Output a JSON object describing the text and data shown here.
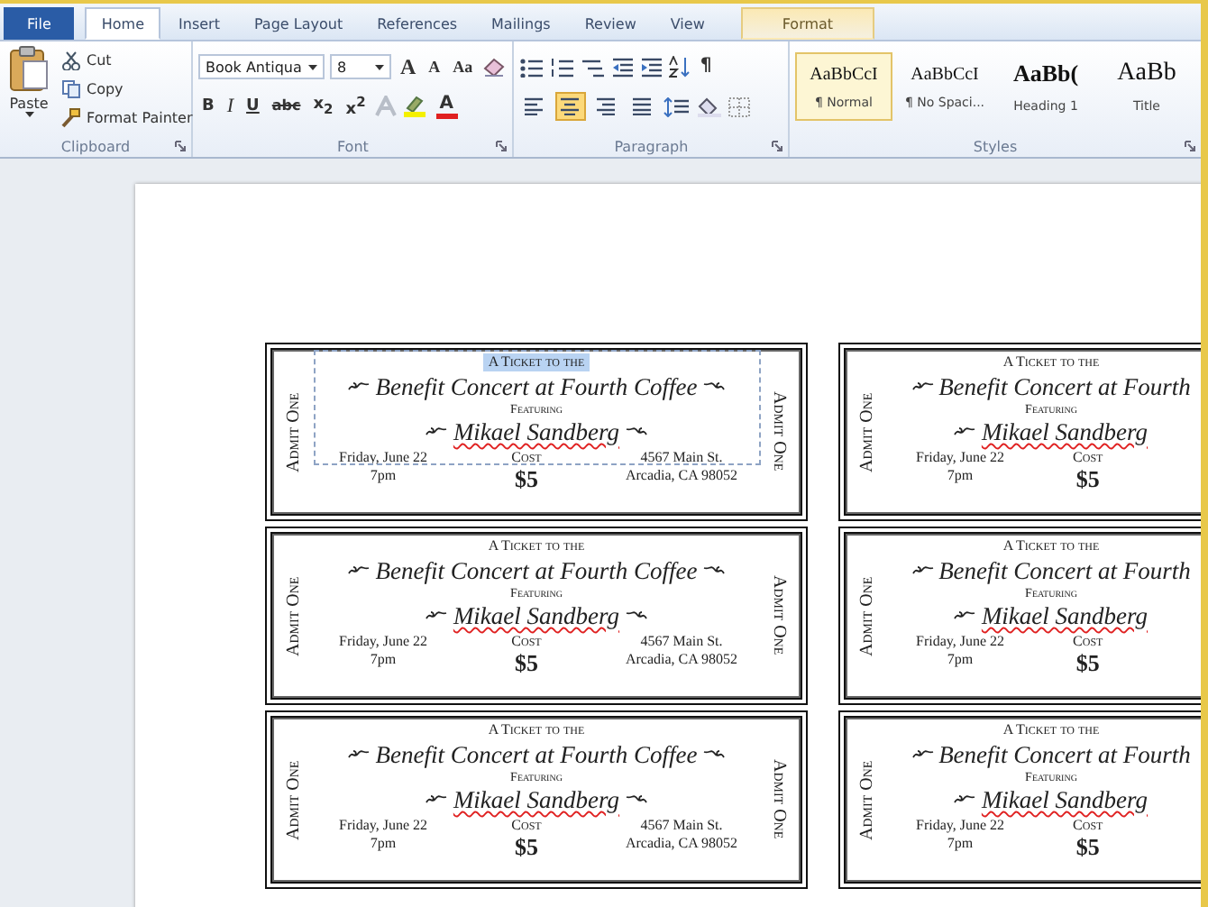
{
  "tabs": [
    {
      "label": "File",
      "kind": "file",
      "selected": false
    },
    {
      "label": "Home",
      "kind": "normal",
      "selected": true
    },
    {
      "label": "Insert",
      "kind": "normal",
      "selected": false
    },
    {
      "label": "Page Layout",
      "kind": "normal",
      "selected": false
    },
    {
      "label": "References",
      "kind": "normal",
      "selected": false
    },
    {
      "label": "Mailings",
      "kind": "normal",
      "selected": false
    },
    {
      "label": "Review",
      "kind": "normal",
      "selected": false
    },
    {
      "label": "View",
      "kind": "normal",
      "selected": false
    },
    {
      "label": "Format",
      "kind": "contextual",
      "selected": false
    }
  ],
  "clipboard": {
    "label": "Clipboard",
    "paste": "Paste",
    "cut": "Cut",
    "copy": "Copy",
    "format_painter": "Format Painter"
  },
  "font": {
    "label": "Font",
    "font_name": "Book Antiqua",
    "font_size": "8",
    "grow": "A",
    "shrink": "A",
    "change_case": "Aa",
    "bold": "B",
    "italic": "I",
    "underline": "U",
    "strikethrough": "abc",
    "subscript": "x$_{2}$",
    "superscript": "x$^{2}$",
    "font_color": "A"
  },
  "paragraph": {
    "label": "Paragraph",
    "pilcrow": "¶",
    "alignment": [
      {
        "selected": false
      },
      {
        "selected": true
      },
      {
        "selected": false
      },
      {
        "selected": false
      }
    ]
  },
  "styles": {
    "label": "Styles",
    "items": [
      {
        "sample": "AaBbCcI",
        "name": "¶ Normal",
        "kind": "normal",
        "selected": true
      },
      {
        "sample": "AaBbCcI",
        "name": "¶ No Spaci...",
        "kind": "normal",
        "selected": false
      },
      {
        "sample": "AaBb(",
        "name": "Heading 1",
        "kind": "heading",
        "selected": false
      },
      {
        "sample": "AaBb",
        "name": "Title",
        "kind": "title",
        "selected": false
      }
    ]
  },
  "tickets": [
    {
      "kind": "full",
      "selected": true,
      "spelling_flagged": true,
      "admit_left": "Admit One",
      "admit_right": "Admit One",
      "heading": "A Ticket to the",
      "title": "Benefit Concert at Fourth Coffee",
      "featuring": "Featuring",
      "performer": "Mikael Sandberg",
      "date": "Friday, June 22",
      "time": "7pm",
      "cost_label": "Cost",
      "price": "$5",
      "address_1": "4567 Main St.",
      "address_2": "Arcadia, CA 98052"
    },
    {
      "kind": "cut",
      "selected": false,
      "spelling_flagged": true,
      "admit_left": "Admit One",
      "heading": "A Ticket to the",
      "title": "Benefit Concert at Fourth",
      "featuring": "Featuring",
      "performer": "Mikael Sandberg",
      "date": "Friday, June 22",
      "time": "7pm",
      "cost_label": "Cost",
      "price": "$5"
    },
    {
      "kind": "full",
      "selected": false,
      "spelling_flagged": true,
      "admit_left": "Admit One",
      "admit_right": "Admit One",
      "heading": "A Ticket to the",
      "title": "Benefit Concert at Fourth Coffee",
      "featuring": "Featuring",
      "performer": "Mikael Sandberg",
      "date": "Friday, June 22",
      "time": "7pm",
      "cost_label": "Cost",
      "price": "$5",
      "address_1": "4567 Main St.",
      "address_2": "Arcadia, CA 98052"
    },
    {
      "kind": "cut",
      "selected": false,
      "spelling_flagged": true,
      "admit_left": "Admit One",
      "heading": "A Ticket to the",
      "title": "Benefit Concert at Fourth",
      "featuring": "Featuring",
      "performer": "Mikael Sandberg",
      "date": "Friday, June 22",
      "time": "7pm",
      "cost_label": "Cost",
      "price": "$5"
    },
    {
      "kind": "full",
      "selected": false,
      "spelling_flagged": true,
      "admit_left": "Admit One",
      "admit_right": "Admit One",
      "heading": "A Ticket to the",
      "title": "Benefit Concert at Fourth Coffee",
      "featuring": "Featuring",
      "performer": "Mikael Sandberg",
      "date": "Friday, June 22",
      "time": "7pm",
      "cost_label": "Cost",
      "price": "$5",
      "address_1": "4567 Main St.",
      "address_2": "Arcadia, CA 98052"
    },
    {
      "kind": "cut",
      "selected": false,
      "spelling_flagged": true,
      "admit_left": "Admit One",
      "heading": "A Ticket to the",
      "title": "Benefit Concert at Fourth",
      "featuring": "Featuring",
      "performer": "Mikael Sandberg",
      "date": "Friday, June 22",
      "time": "7pm",
      "cost_label": "Cost",
      "price": "$5"
    }
  ]
}
